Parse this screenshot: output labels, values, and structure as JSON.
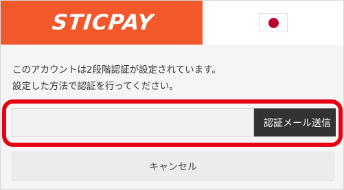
{
  "brand": {
    "logo_text": "STICPAY",
    "accent_color": "#f1582a"
  },
  "language": {
    "flag_icon": "japan-flag-icon"
  },
  "message": {
    "line1": "このアカウントは2段階認証が設定されています。",
    "line2": "設定した方法で認証を行ってください。"
  },
  "verification": {
    "code_value": "",
    "code_placeholder": "",
    "send_label": "認証メール送信",
    "highlight_color": "#e60012"
  },
  "actions": {
    "cancel_label": "キャンセル"
  }
}
